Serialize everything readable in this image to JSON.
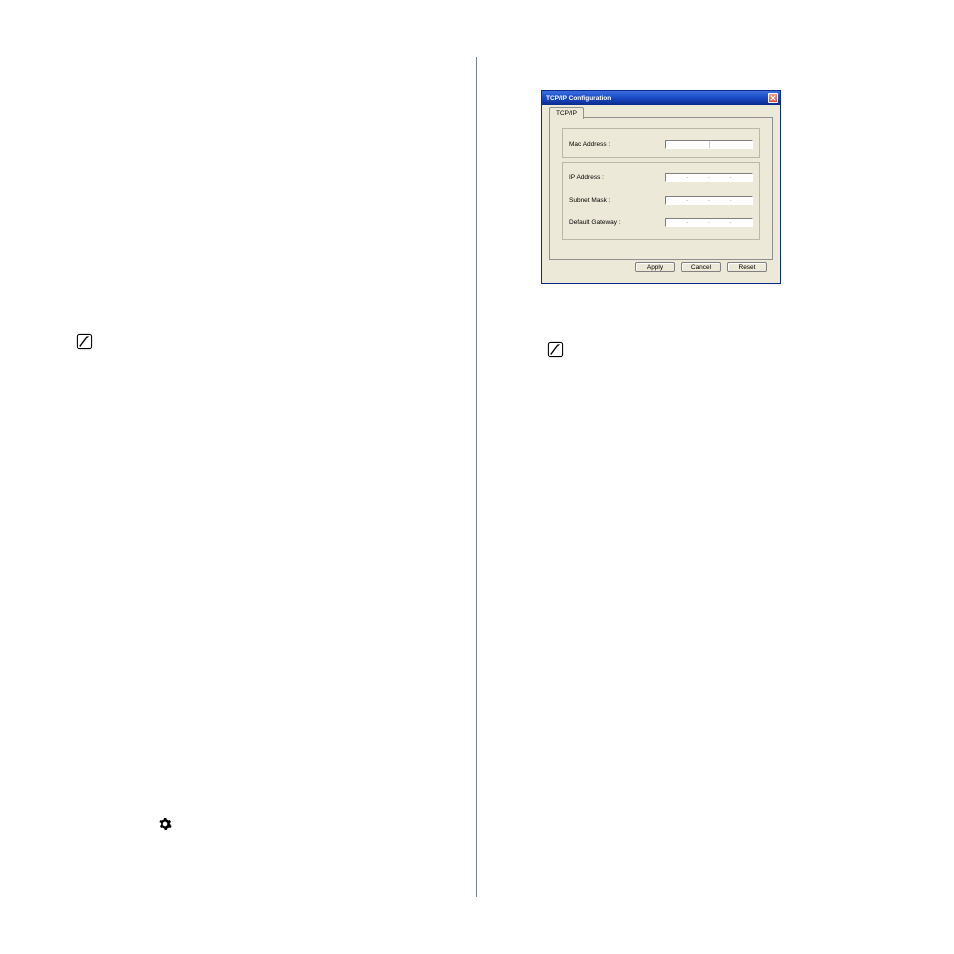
{
  "dialog": {
    "title": "TCP/IP Configuration",
    "tab_label": "TCP/IP",
    "labels": {
      "mac": "Mac Address :",
      "ip": "IP Address :",
      "subnet": "Subnet Mask :",
      "gateway": "Default Gateway :"
    },
    "fields": {
      "mac": "",
      "ip": "",
      "subnet": "",
      "gateway": ""
    },
    "buttons": {
      "apply": "Apply",
      "cancel": "Cancel",
      "reset": "Reset"
    }
  },
  "icons": {
    "note_left": "note-icon",
    "note_right": "note-icon",
    "gear": "gear-icon"
  }
}
